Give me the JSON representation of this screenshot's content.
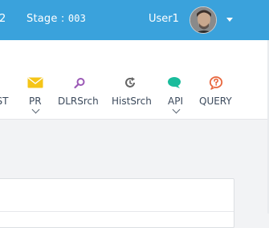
{
  "header": {
    "env_fragment": "2",
    "stage_label": "Stage : ",
    "stage_code": "003",
    "user_name": "User1"
  },
  "toolbar": {
    "items": [
      {
        "label": "JST",
        "icon": "truncated-icon",
        "has_dropdown": false
      },
      {
        "label": "PR",
        "icon": "envelope-icon",
        "color": "#f5c518",
        "has_dropdown": true
      },
      {
        "label": "DLRSrch",
        "icon": "magnifier-icon",
        "color": "#9b59b6",
        "has_dropdown": false
      },
      {
        "label": "HistSrch",
        "icon": "history-icon",
        "color": "#666666",
        "has_dropdown": false
      },
      {
        "label": "API",
        "icon": "chat-bubble-icon",
        "color": "#1abc9c",
        "has_dropdown": true
      },
      {
        "label": "QUERY",
        "icon": "question-bubble-icon",
        "color": "#e8663d",
        "has_dropdown": false
      }
    ]
  },
  "colors": {
    "header_bg": "#3aa2dc",
    "toolbar_bg": "#ffffff",
    "page_bg": "#f2f3f5",
    "label_text": "#3c4a5c"
  }
}
